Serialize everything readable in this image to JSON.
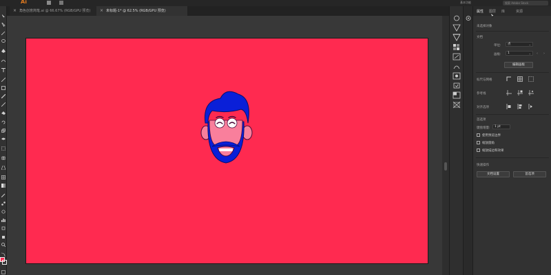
{
  "app": {
    "logo": "Ai"
  },
  "topbar": {
    "workspace_label": "基本功能",
    "search_placeholder": "搜索 Adobe Stock"
  },
  "doc_tabs": [
    {
      "label": "角色创意简笔.ai @ 66.67% (RGB/GPU 预览)",
      "active": false
    },
    {
      "label": "未标题-1* @ 62.5% (RGB/GPU 预览)",
      "active": true
    }
  ],
  "colors": {
    "artboard": "#ff2a50",
    "hair_beard": "#0a1fd8",
    "skin": "#f97f9c",
    "fill_swatch": "#ff2a50"
  },
  "panel": {
    "tabs": [
      "属性",
      "图层",
      "库",
      "资源"
    ],
    "no_selection": "未选择对象",
    "document_section": "文档",
    "units_label": "单位:",
    "units_value": "点",
    "artboard_label": "画板:",
    "artboard_value": "1",
    "edit_artboards_btn": "编辑画板",
    "rulers_grids": "标尺与网格",
    "guides": "参考线",
    "align_options": "对齐选项",
    "preferences_section": "首选项",
    "keyboard_increment_label": "键盘增量:",
    "keyboard_increment_value": "1 pt",
    "checkbox_preview_bounds": "使用预览边界",
    "checkbox_scale_corners": "缩放圆角",
    "checkbox_scale_strokes": "缩放描边和效果",
    "quick_actions": "快速操作",
    "doc_setup_btn": "文档设置",
    "preferences_btn": "首选项"
  }
}
